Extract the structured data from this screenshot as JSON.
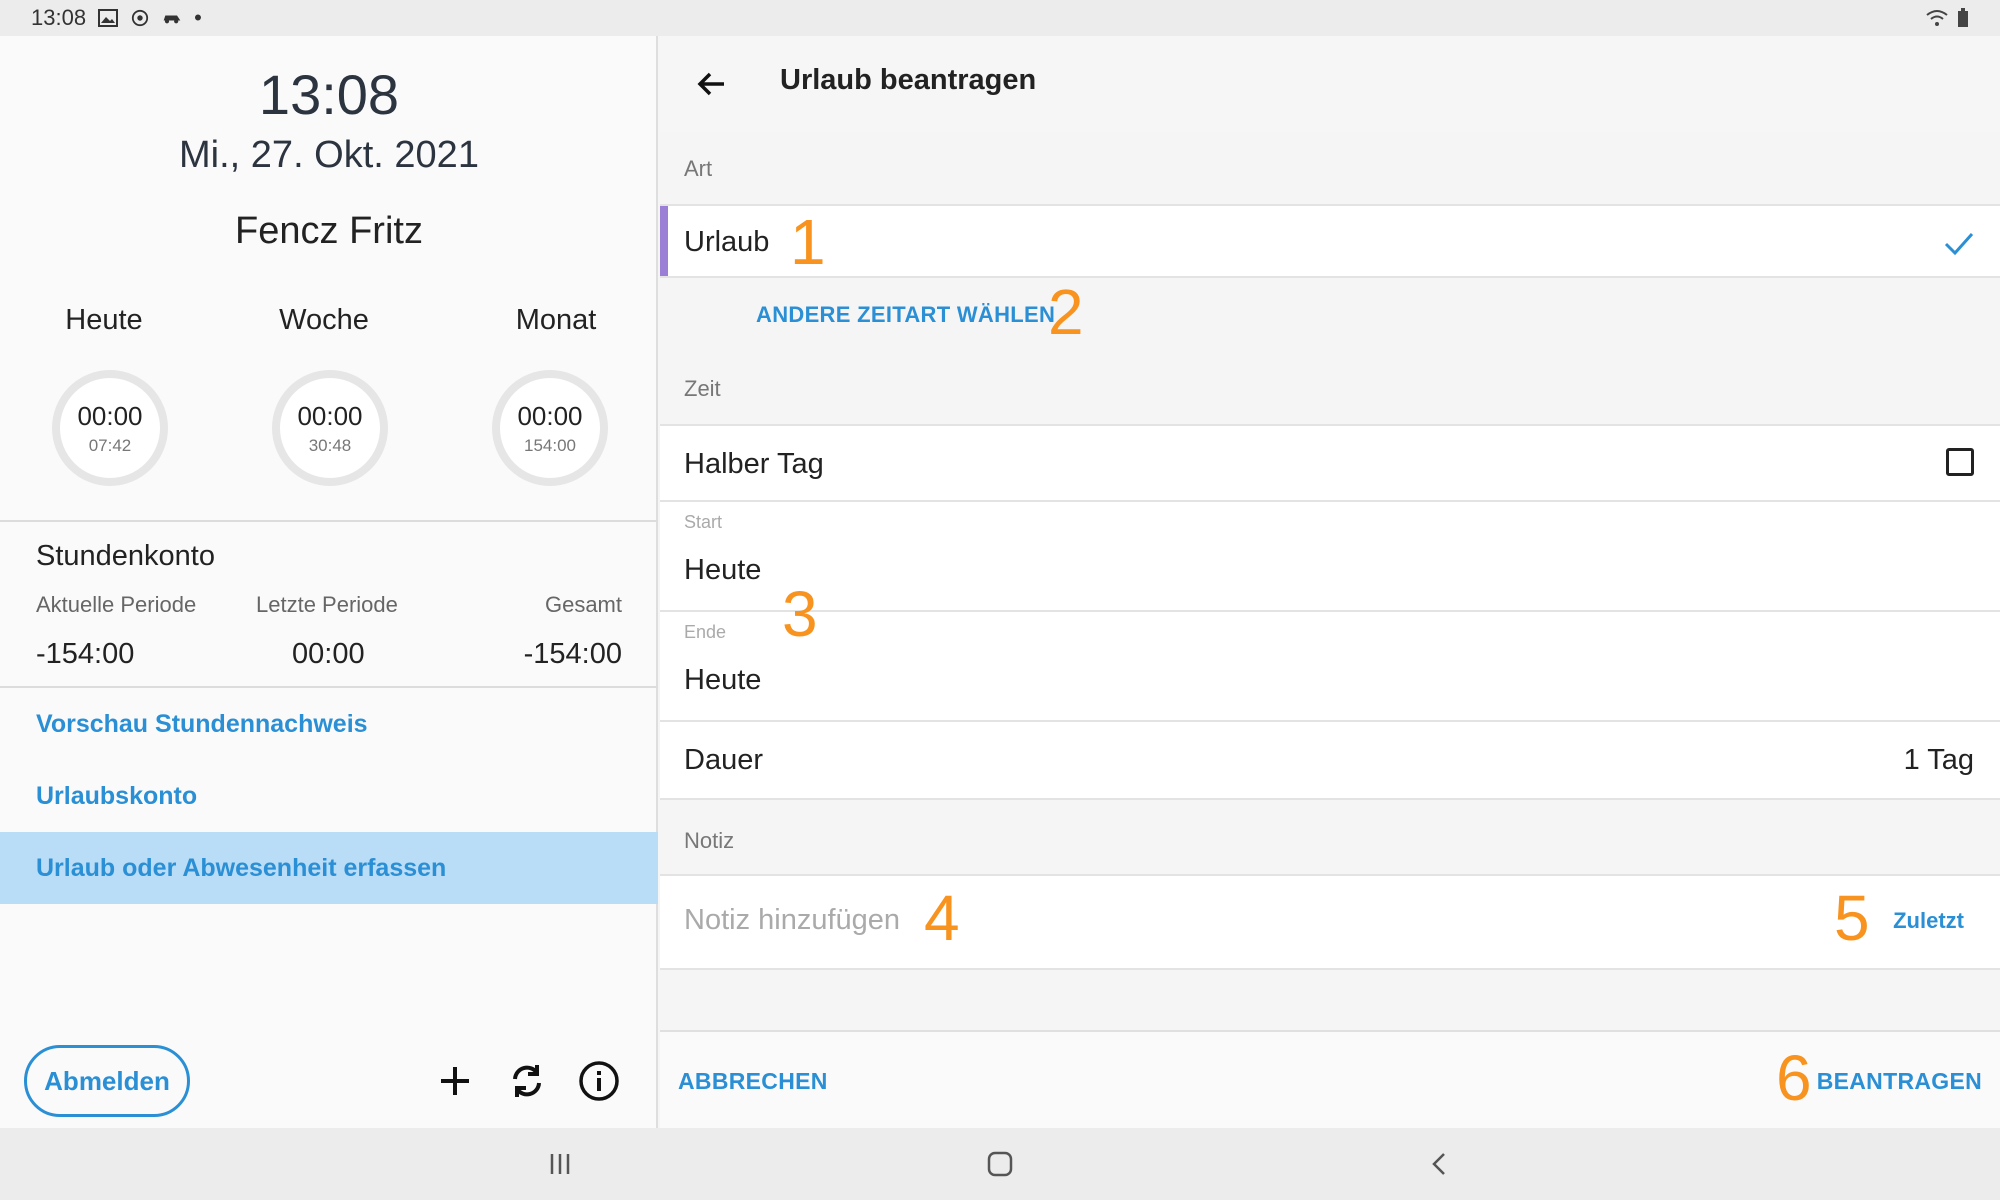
{
  "status_bar": {
    "time": "13:08",
    "dot": "•"
  },
  "left": {
    "clock": "13:08",
    "date": "Mi., 27. Okt. 2021",
    "user_name": "Fencz Fritz",
    "periods": [
      {
        "label": "Heute",
        "value": "00:00",
        "target": "07:42"
      },
      {
        "label": "Woche",
        "value": "00:00",
        "target": "30:48"
      },
      {
        "label": "Monat",
        "value": "00:00",
        "target": "154:00"
      }
    ],
    "stundenkonto": {
      "title": "Stundenkonto",
      "columns": [
        {
          "label": "Aktuelle Periode",
          "value": "-154:00"
        },
        {
          "label": "Letzte Periode",
          "value": "00:00"
        },
        {
          "label": "Gesamt",
          "value": "-154:00"
        }
      ]
    },
    "nav": [
      {
        "label": "Vorschau Stundennachweis"
      },
      {
        "label": "Urlaubskonto"
      },
      {
        "label": "Urlaub oder Abwesenheit erfassen"
      }
    ],
    "logout_label": "Abmelden",
    "icons": [
      "plus-icon",
      "sync-icon",
      "info-icon"
    ]
  },
  "right": {
    "title": "Urlaub beantragen",
    "art": {
      "label": "Art",
      "selected": "Urlaub",
      "change_label": "ANDERE ZEITART WÄHLEN"
    },
    "zeit": {
      "label": "Zeit",
      "half_day_label": "Halber Tag",
      "half_day_checked": false,
      "start_label": "Start",
      "start_value": "Heute",
      "end_label": "Ende",
      "end_value": "Heute",
      "duration_label": "Dauer",
      "duration_value": "1 Tag"
    },
    "notiz": {
      "label": "Notiz",
      "placeholder": "Notiz hinzufügen",
      "recent_label": "Zuletzt"
    },
    "footer": {
      "cancel_label": "ABBRECHEN",
      "submit_label": "BEANTRAGEN"
    }
  },
  "annotations": [
    "1",
    "2",
    "3",
    "4",
    "5",
    "6"
  ],
  "colors": {
    "accent": "#2a8fd4",
    "selected_bar": "#9b7fd6",
    "annotation": "#f7931e",
    "active_nav": "#b9dcf7"
  }
}
